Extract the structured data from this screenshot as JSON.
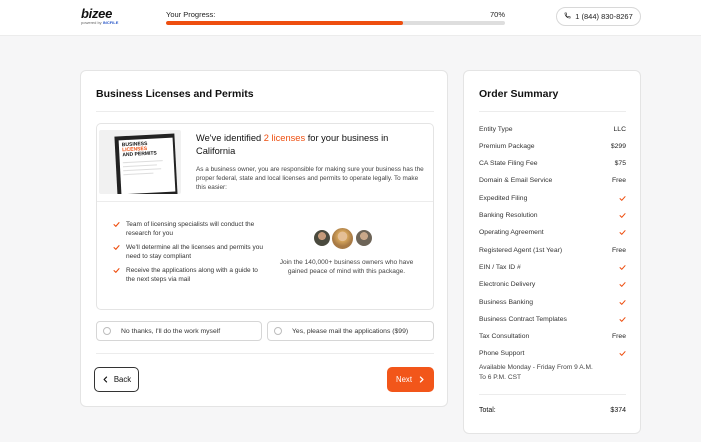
{
  "brand": {
    "name": "bizee",
    "tagline_prefix": "powered by",
    "tagline_brand": "INCFILE"
  },
  "progress": {
    "label": "Your Progress:",
    "percent_text": "70%",
    "percent": 70
  },
  "phone": {
    "number": "1 (844) 830-8267",
    "icon": "phone-icon"
  },
  "main": {
    "title": "Business Licenses and Permits",
    "document_image": {
      "line1": "BUSINESS",
      "line2": "LICENSES",
      "line3": "AND PERMITS"
    },
    "headline_prefix": "We've identified ",
    "headline_highlight": "2 licenses",
    "headline_suffix": " for your business in California",
    "description": "As a business owner, you are responsible for making sure your business has the proper federal, state and local licenses and permits to operate legally. To make this easier:",
    "bullets": [
      "Team of licensing specialists will conduct the research for you",
      "We'll determine all the licenses and permits you need to stay compliant",
      "Receive the applications along with a guide to the next steps via mail"
    ],
    "join_text": "Join the 140,000+ business owners who have gained peace of mind with this package.",
    "options": [
      "No thanks, I'll do the work myself",
      "Yes, please mail the applications ($99)"
    ],
    "back_label": "Back",
    "next_label": "Next"
  },
  "summary": {
    "title": "Order Summary",
    "items": [
      {
        "label": "Entity Type",
        "value": "LLC"
      },
      {
        "label": "Premium Package",
        "value": "$299"
      },
      {
        "label": "CA State Filing Fee",
        "value": "$75"
      },
      {
        "label": "Domain & Email Service",
        "value": "Free"
      },
      {
        "label": "Expedited Filing",
        "value": "check"
      },
      {
        "label": "Banking Resolution",
        "value": "check"
      },
      {
        "label": "Operating Agreement",
        "value": "check"
      },
      {
        "label": "Registered Agent (1st Year)",
        "value": "Free"
      },
      {
        "label": "EIN / Tax ID #",
        "value": "check"
      },
      {
        "label": "Electronic Delivery",
        "value": "check"
      },
      {
        "label": "Business Banking",
        "value": "check"
      },
      {
        "label": "Business Contract Templates",
        "value": "check"
      },
      {
        "label": "Tax Consultation",
        "value": "Free"
      },
      {
        "label": "Phone Support",
        "value": "check"
      }
    ],
    "hours": "Available Monday - Friday From 9 A.M. To 6 P.M. CST",
    "total_label": "Total:",
    "total_value": "$374"
  },
  "colors": {
    "accent": "#ee4e0f",
    "button": "#f2561a",
    "check": "#ee4e0f"
  }
}
